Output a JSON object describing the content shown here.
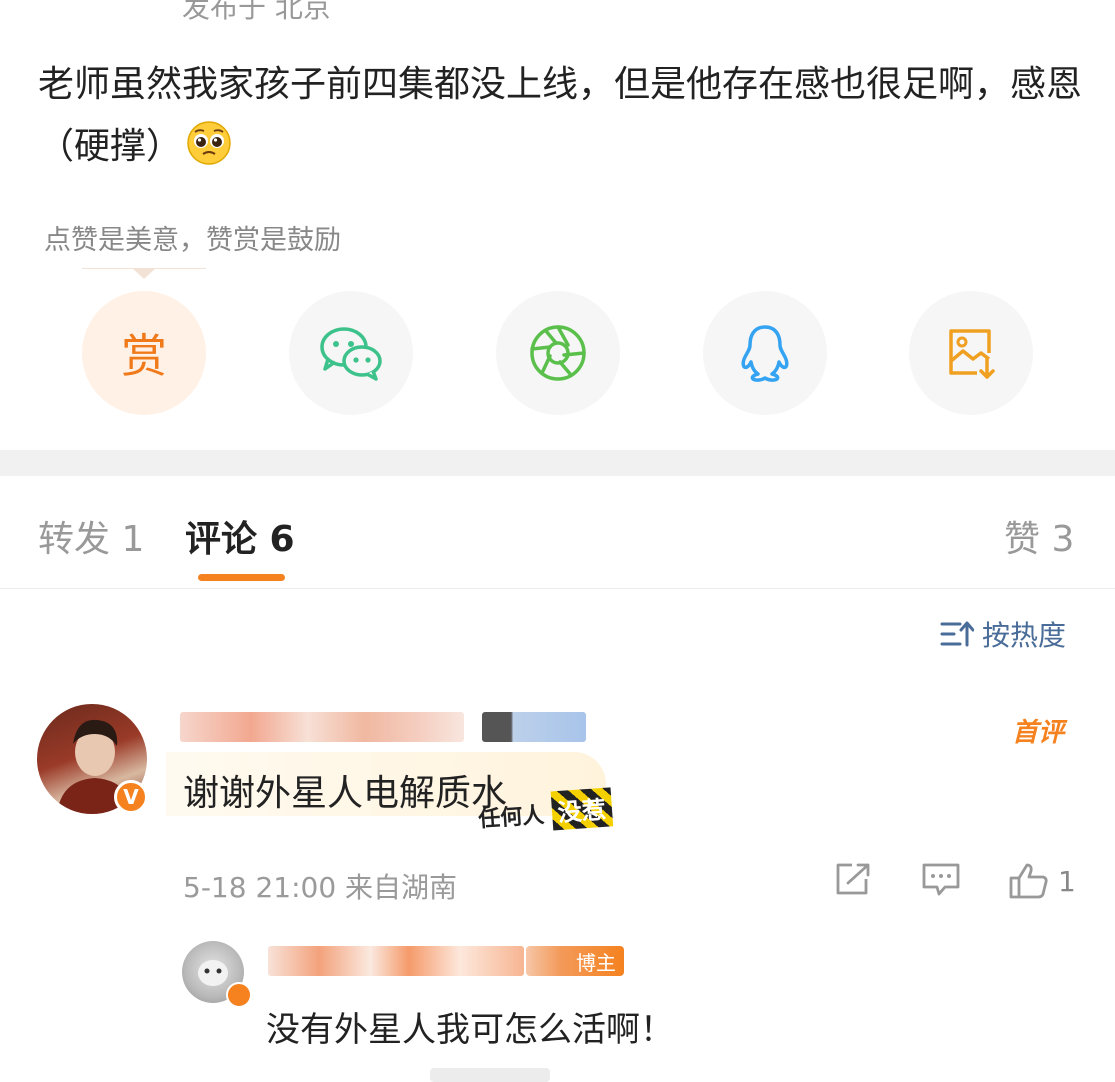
{
  "post": {
    "location": "发布于 北京",
    "text": "老师虽然我家孩子前四集都没上线，但是他存在感也很足啊，感恩（硬撑）"
  },
  "reward_tip": "点赞是美意，赞赏是鼓励",
  "share_buttons": [
    {
      "name": "reward",
      "label": "赏",
      "color": "#f07a1a"
    },
    {
      "name": "wechat",
      "icon": "wechat-icon",
      "color": "#3cc28a"
    },
    {
      "name": "moments",
      "icon": "aperture-icon",
      "color": "#5ac04b"
    },
    {
      "name": "qq",
      "icon": "qq-penguin-icon",
      "color": "#33a3f2"
    },
    {
      "name": "save-image",
      "icon": "save-image-icon",
      "color": "#f0a020"
    }
  ],
  "tabs": {
    "repost": "转发 1",
    "comment": "评论 6",
    "like": "赞 3"
  },
  "sort_label": "按热度",
  "comments": [
    {
      "badge": "首评",
      "text": "谢谢外星人电解质水",
      "sticker_left": "任何人",
      "sticker_right": "没惹",
      "meta": "5-18 21:00  来自湖南",
      "like_count": "1",
      "verified_mark": "V"
    }
  ],
  "reply": {
    "badge": "博主",
    "text": "没有外星人我可怎么活啊！"
  },
  "colors": {
    "accent": "#f5821f",
    "link_blue": "#4a6c98"
  }
}
